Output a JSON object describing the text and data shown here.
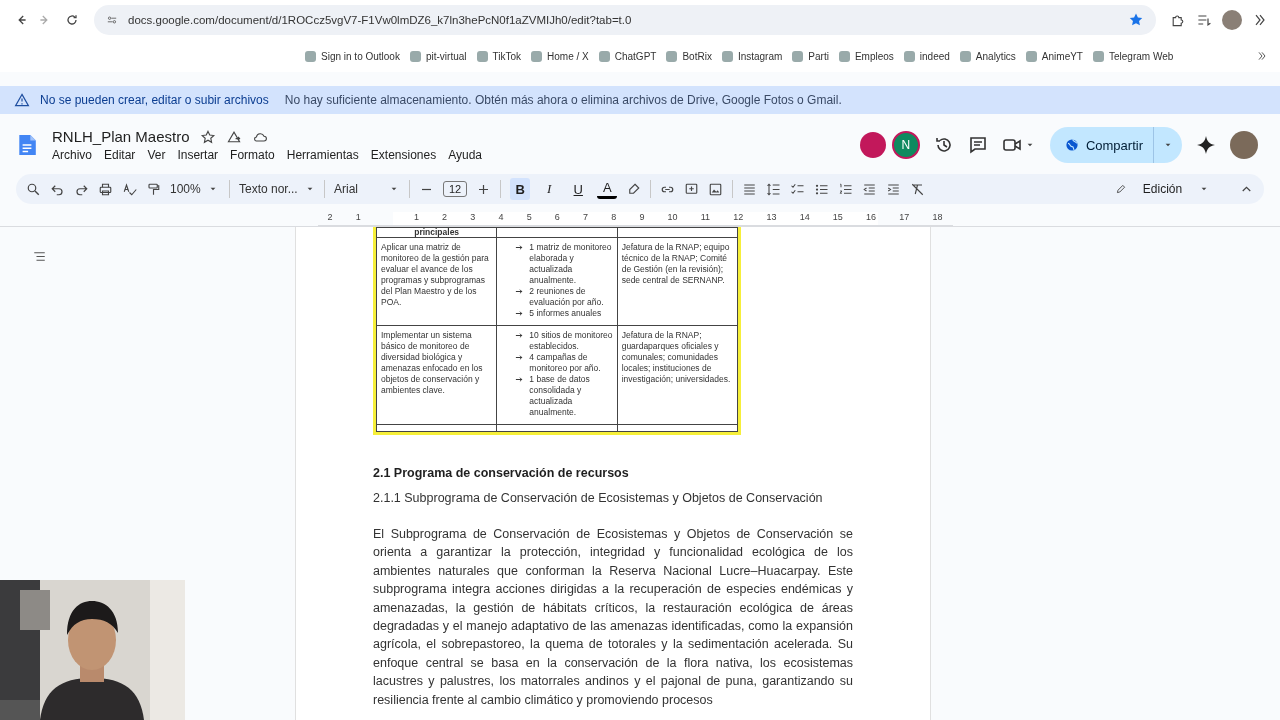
{
  "browser": {
    "url": "docs.google.com/document/d/1ROCcz5vgV7-F1Vw0lmDZ6_k7ln3hePcN0f1aZVMIJh0/edit?tab=t.0",
    "bookmarks": [
      "Sign in to Outlook",
      "pit-virtual",
      "TikTok",
      "Home / X",
      "ChatGPT",
      "BotRix",
      "Instagram",
      "Parti",
      "Empleos",
      "indeed",
      "Analytics",
      "AnimeYT",
      "Telegram Web"
    ]
  },
  "banner": {
    "title": "No se pueden crear, editar o subir archivos",
    "message": "No hay suficiente almacenamiento. Obtén más ahora o elimina archivos de Drive, Google Fotos o Gmail."
  },
  "doc": {
    "title": "RNLH_Plan Maestro",
    "starred": false,
    "menus": [
      "Archivo",
      "Editar",
      "Ver",
      "Insertar",
      "Formato",
      "Herramientas",
      "Extensiones",
      "Ayuda"
    ],
    "collaborator_initial": "N",
    "share_label": "Compartir"
  },
  "toolbar": {
    "zoom": "100%",
    "style": "Texto nor...",
    "font": "Arial",
    "size": "12",
    "bold": true,
    "italic": false,
    "underline": false,
    "bold_label": "B",
    "italic_label": "I",
    "underline_label": "U",
    "text_color_label": "A",
    "mode": "Edición"
  },
  "ruler": [
    "2",
    "1",
    "1",
    "2",
    "3",
    "4",
    "5",
    "6",
    "7",
    "8",
    "9",
    "10",
    "11",
    "12",
    "13",
    "14",
    "15",
    "16",
    "17",
    "18"
  ],
  "table": {
    "header": "principales",
    "rows": [
      {
        "action": "Aplicar una matriz de monitoreo de la gestión para evaluar el avance de los programas y subprogramas del Plan Maestro y de los POA.",
        "results": [
          "1 matriz de monitoreo elaborada y actualizada anualmente.",
          "2 reuniones de evaluación por año.",
          "5 informes anuales"
        ],
        "responsible": "Jefatura de la RNAP; equipo técnico de la RNAP; Comité de Gestión (en la revisión); sede central de SERNANP."
      },
      {
        "action": "Implementar un sistema básico de monitoreo de diversidad biológica y amenazas enfocado en los objetos de conservación y ambientes clave.",
        "results": [
          "10 sitios de monitoreo establecidos.",
          "4 campañas de monitoreo por año.",
          "1 base de datos consolidada y actualizada anualmente."
        ],
        "responsible": "Jefatura de la RNAP; guardaparques oficiales y comunales; comunidades locales; instituciones de investigación; universidades."
      }
    ]
  },
  "heading": "2.1 Programa de conservación de recursos",
  "subheading": "2.1.1 Subprograma de Conservación de Ecosistemas y Objetos de Conservación",
  "paragraph": "El Subprograma de Conservación de Ecosistemas y Objetos de Conservación se orienta a garantizar la protección, integridad y funcionalidad ecológica de los ambientes naturales que conforman la Reserva Nacional Lucre–Huacarpay. Este subprograma integra acciones dirigidas a la recuperación de especies endémicas y amenazadas, la gestión de hábitats críticos, la restauración ecológica de áreas degradadas y el manejo adaptativo de las amenazas identificadas, como la expansión agrícola, el sobrepastoreo, la quema de totorales y la sedimentación acelerada. Su enfoque central se basa en la conservación de la flora nativa, los ecosistemas lacustres y palustres, los matorrales andinos y el pajonal de puna, garantizando su resiliencia frente al cambio climático y promoviendo procesos"
}
